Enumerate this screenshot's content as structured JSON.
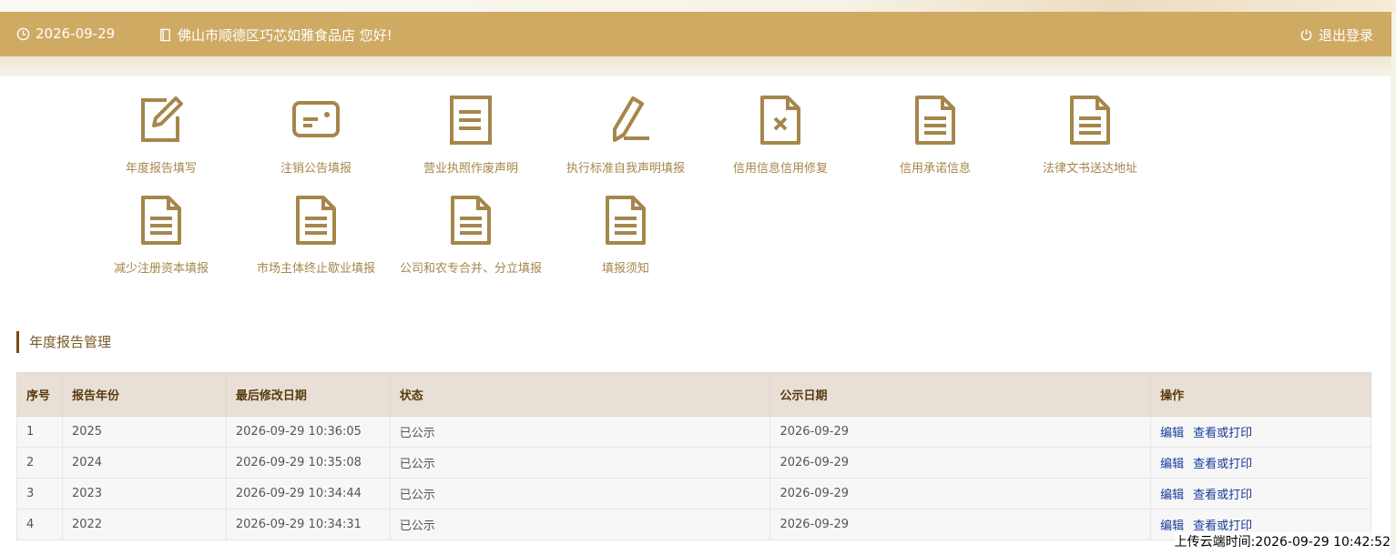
{
  "header": {
    "date": "2026-09-29",
    "greeting": "佛山市顺德区巧芯如雅食品店 您好!",
    "logout": "退出登录"
  },
  "tiles": [
    {
      "label": "年度报告填写",
      "icon": "edit-icon"
    },
    {
      "label": "注销公告填报",
      "icon": "id-card-icon"
    },
    {
      "label": "营业执照作废声明",
      "icon": "document-icon"
    },
    {
      "label": "执行标准自我声明填报",
      "icon": "pencil-icon"
    },
    {
      "label": "信用信息信用修复",
      "icon": "document-x-icon"
    },
    {
      "label": "信用承诺信息",
      "icon": "document-icon"
    },
    {
      "label": "法律文书送达地址",
      "icon": "document-icon"
    },
    {
      "label": "减少注册资本填报",
      "icon": "document-icon"
    },
    {
      "label": "市场主体终止歇业填报",
      "icon": "document-icon"
    },
    {
      "label": "公司和农专合并、分立填报",
      "icon": "document-icon"
    },
    {
      "label": "填报须知",
      "icon": "document-icon"
    }
  ],
  "section": {
    "title": "年度报告管理"
  },
  "table": {
    "headers": [
      "序号",
      "报告年份",
      "最后修改日期",
      "状态",
      "公示日期",
      "操作"
    ],
    "rows": [
      [
        "1",
        "2025",
        "2026-09-29 10:36:05",
        "已公示",
        "2026-09-29"
      ],
      [
        "2",
        "2024",
        "2026-09-29 10:35:08",
        "已公示",
        "2026-09-29"
      ],
      [
        "3",
        "2023",
        "2026-09-29 10:34:44",
        "已公示",
        "2026-09-29"
      ],
      [
        "4",
        "2022",
        "2026-09-29 10:34:31",
        "已公示",
        "2026-09-29"
      ]
    ],
    "action_edit": "编辑",
    "action_view": "查看或打印"
  },
  "upload_time": "上传云端时间:2026-09-29 10:42:52",
  "colors": {
    "header": "#cfaa63",
    "icon": "#a5864b",
    "link": "#1a3a9a"
  }
}
